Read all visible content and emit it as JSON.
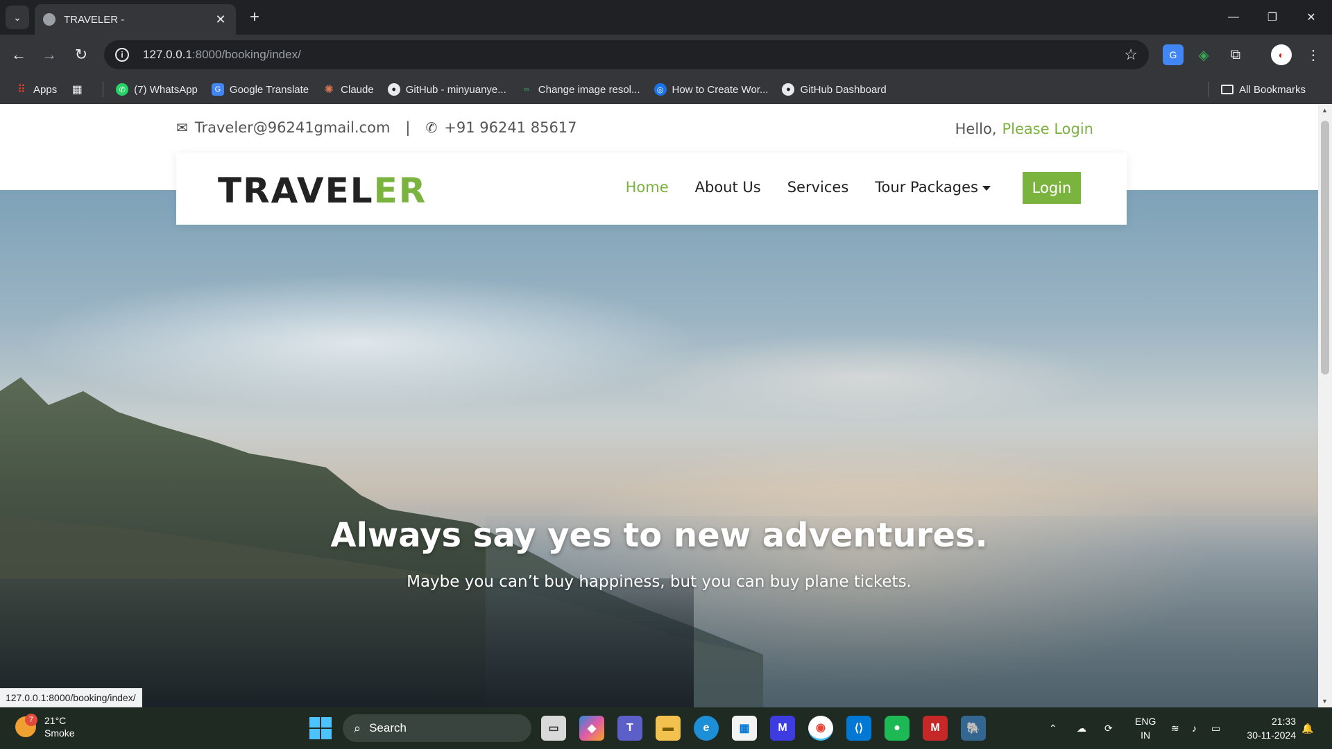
{
  "browser": {
    "tab_title": "TRAVELER -",
    "tab_close": "✕",
    "new_tab": "+",
    "url_host": "127.0.0.1",
    "url_rest": ":8000/booking/index/",
    "status_url": "127.0.0.1:8000/booking/index/",
    "bookmarks": [
      {
        "label": "Apps",
        "icon": "apps-grid-icon",
        "color": "#ea4335"
      },
      {
        "label": "(7) WhatsApp",
        "icon": "whatsapp-icon",
        "color": "#25d366"
      },
      {
        "label": "Google Translate",
        "icon": "google-translate-icon",
        "color": "#4285f4"
      },
      {
        "label": "Claude",
        "icon": "claude-icon",
        "color": "#d97757"
      },
      {
        "label": "GitHub - minyuanye...",
        "icon": "github-icon",
        "color": "#000000"
      },
      {
        "label": "Change image resol...",
        "icon": "image-resize-icon",
        "color": "#34a853"
      },
      {
        "label": "How to Create Wor...",
        "icon": "cosmos-icon",
        "color": "#1a73e8"
      },
      {
        "label": "GitHub Dashboard",
        "icon": "github-icon",
        "color": "#000000"
      }
    ],
    "all_bookmarks": "All Bookmarks"
  },
  "site": {
    "email": "Traveler@96241gmail.com",
    "phone": "+91 96241 85617",
    "hello": "Hello,",
    "please_login": "Please Login",
    "logo_main": "TRAVEL",
    "logo_accent": "ER",
    "nav": {
      "home": "Home",
      "about": "About Us",
      "services": "Services",
      "packages": "Tour Packages",
      "login": "Login"
    },
    "hero_title": "Always say yes to new adventures.",
    "hero_subtitle": "Maybe you can’t buy happiness, but you can buy plane tickets.",
    "accent_color": "#7ab33e"
  },
  "taskbar": {
    "temperature": "21°C",
    "weather": "Smoke",
    "weather_badge": "7",
    "search": "Search",
    "lang_line1": "ENG",
    "lang_line2": "IN",
    "time": "21:33",
    "date": "30-11-2024"
  }
}
